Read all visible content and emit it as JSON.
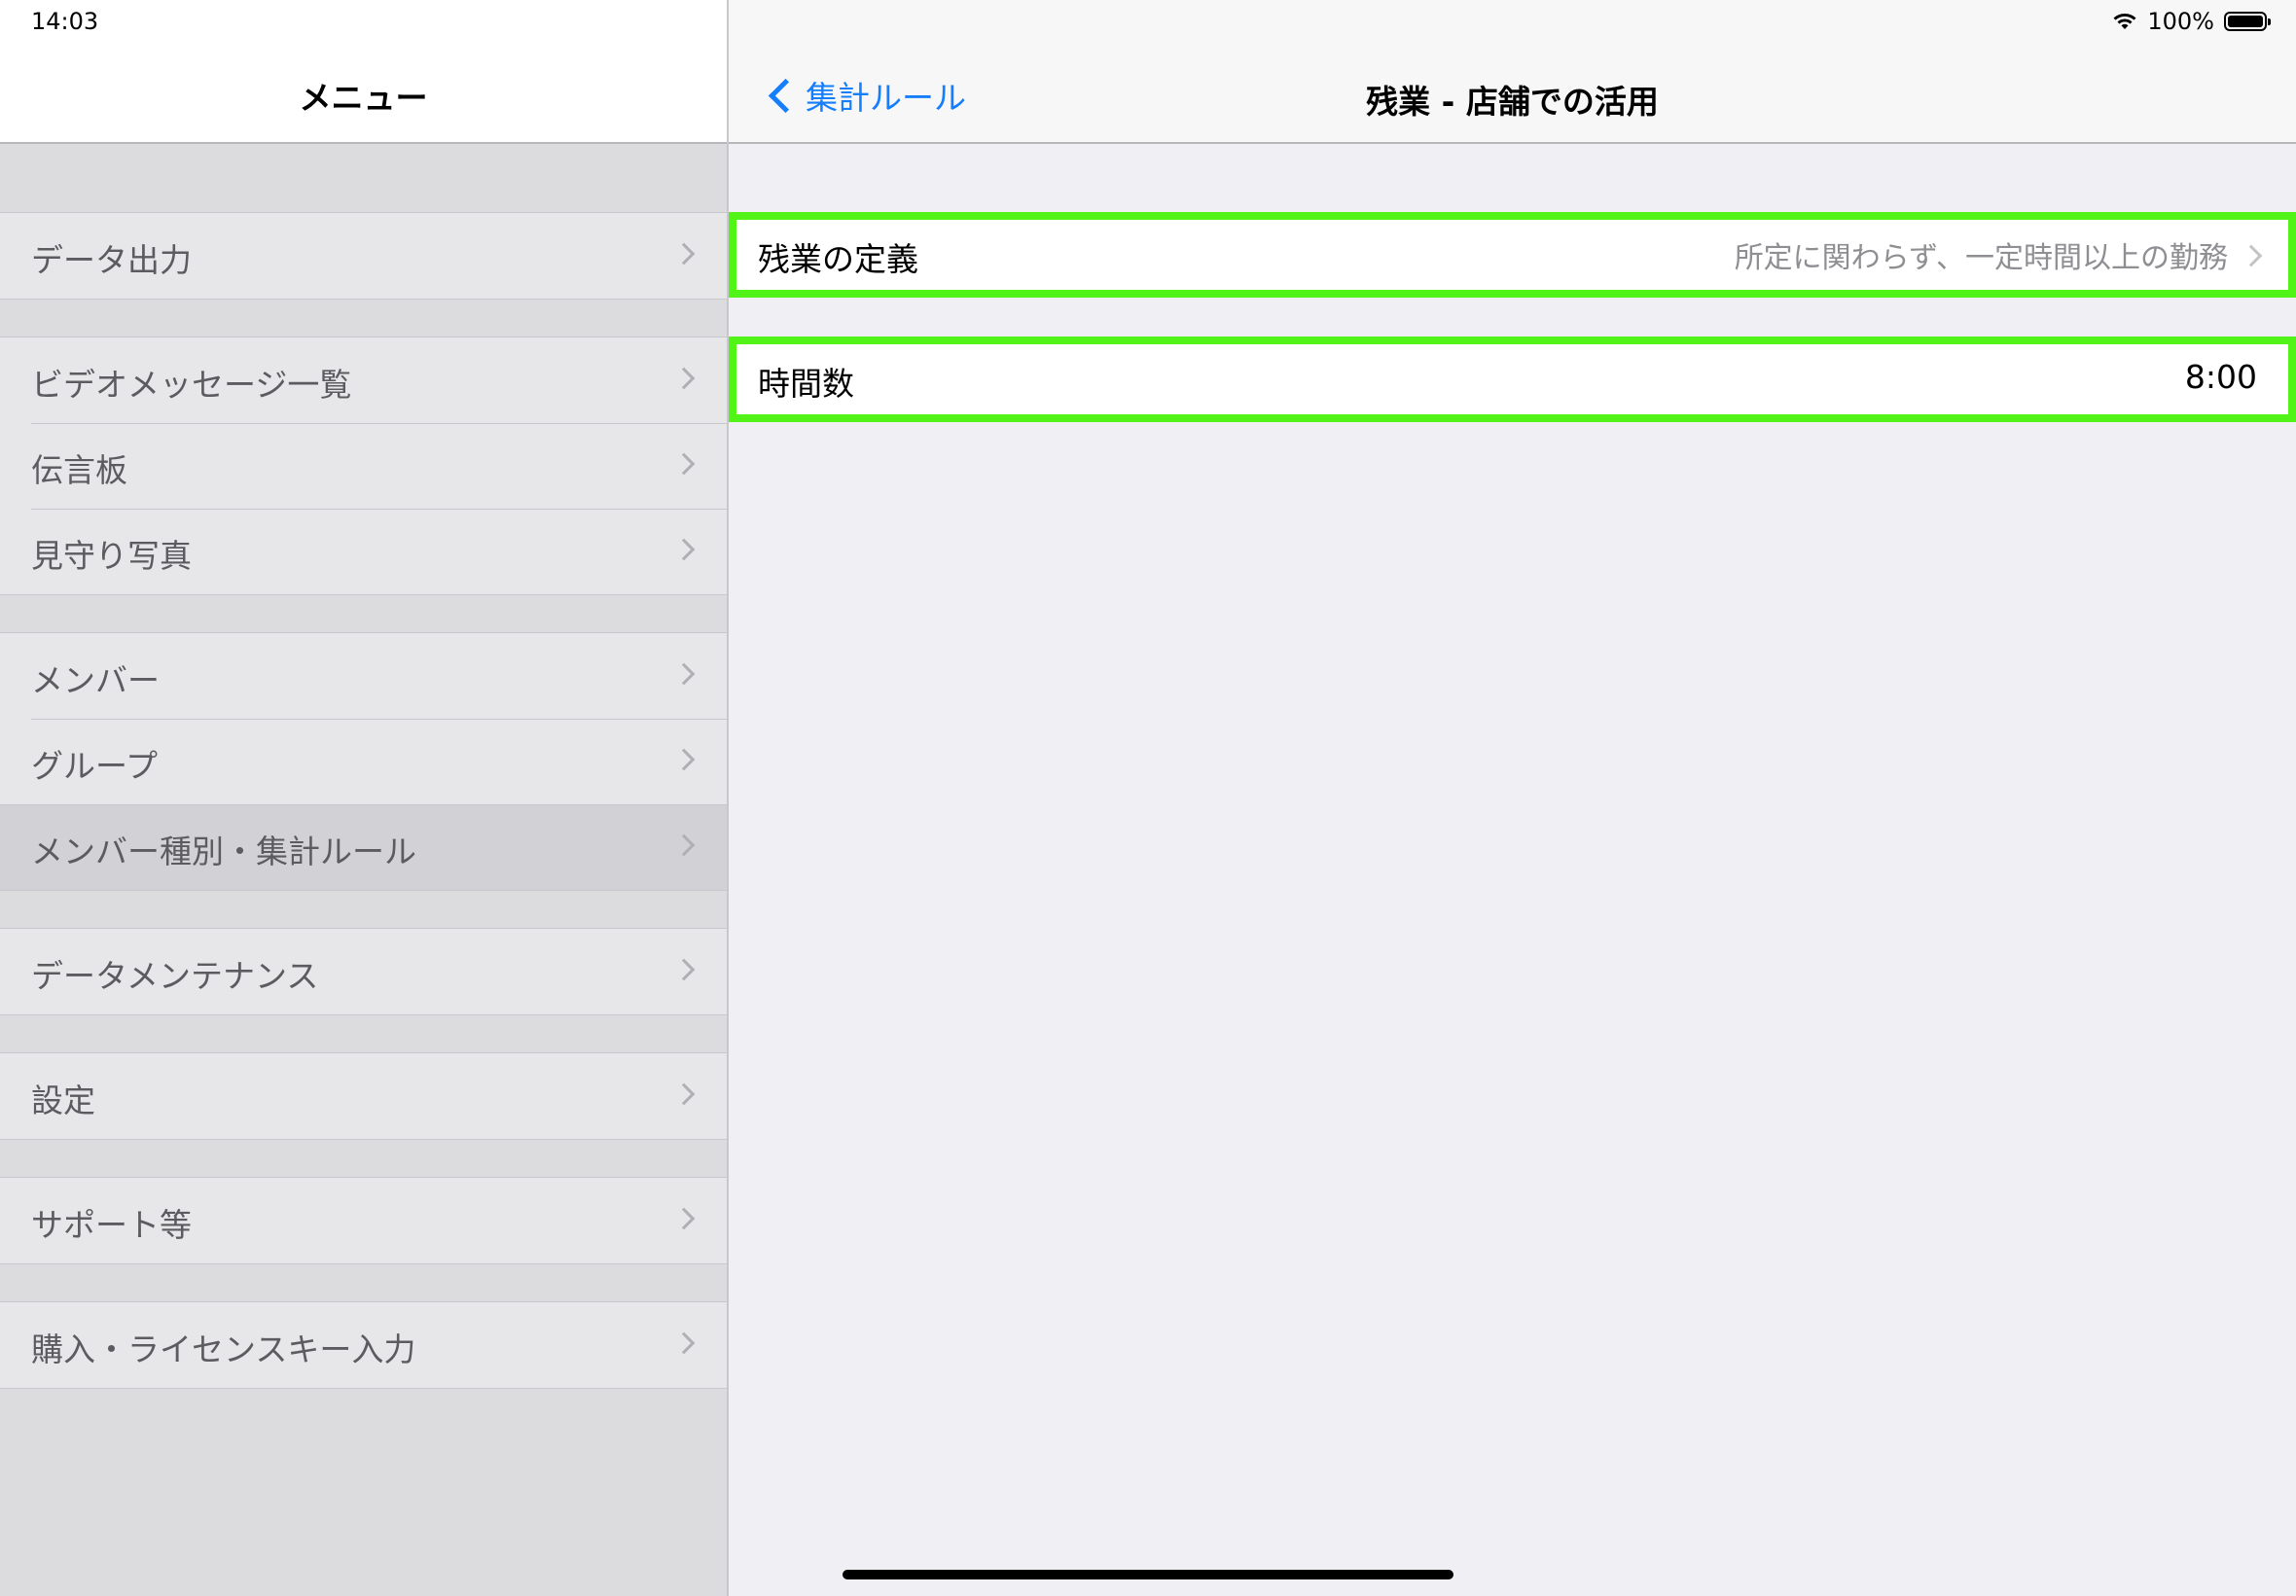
{
  "status_bar": {
    "time": "14:03",
    "battery": "100%"
  },
  "master": {
    "title": "メニュー",
    "groups": [
      {
        "items": [
          {
            "label": "データ出力"
          }
        ]
      },
      {
        "items": [
          {
            "label": "ビデオメッセージ一覧"
          },
          {
            "label": "伝言板"
          },
          {
            "label": "見守り写真"
          }
        ]
      },
      {
        "items": [
          {
            "label": "メンバー"
          },
          {
            "label": "グループ"
          },
          {
            "label": "メンバー種別・集計ルール",
            "selected": true
          }
        ]
      },
      {
        "items": [
          {
            "label": "データメンテナンス"
          }
        ]
      },
      {
        "items": [
          {
            "label": "設定"
          }
        ]
      },
      {
        "items": [
          {
            "label": "サポート等"
          }
        ]
      },
      {
        "items": [
          {
            "label": "購入・ライセンスキー入力"
          }
        ]
      }
    ]
  },
  "detail": {
    "back_label": "集計ルール",
    "title": "残業 - 店舗での活用",
    "rows": [
      {
        "label": "残業の定義",
        "value": "所定に関わらず、一定時間以上の勤務"
      },
      {
        "label": "時間数",
        "value": "8:00"
      }
    ]
  },
  "colors": {
    "accent": "#157efb",
    "highlight": "#52f316"
  }
}
